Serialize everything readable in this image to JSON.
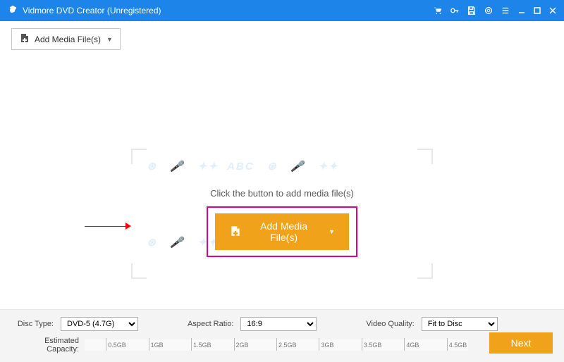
{
  "titlebar": {
    "app": "Vidmore DVD Creator (Unregistered)"
  },
  "toolbar": {
    "add_label": "Add Media File(s)"
  },
  "main": {
    "instruction": "Click the button to add media file(s)",
    "center_btn": "Add Media File(s)",
    "watermark_token": "ABC"
  },
  "bottom": {
    "disc_type_label": "Disc Type:",
    "disc_type_value": "DVD-5 (4.7G)",
    "aspect_label": "Aspect Ratio:",
    "aspect_value": "16:9",
    "vq_label": "Video Quality:",
    "vq_value": "Fit to Disc",
    "ec_label": "Estimated Capacity:",
    "ticks": [
      "0.5GB",
      "1GB",
      "1.5GB",
      "2GB",
      "2.5GB",
      "3GB",
      "3.5GB",
      "4GB",
      "4.5GB"
    ],
    "next": "Next"
  }
}
